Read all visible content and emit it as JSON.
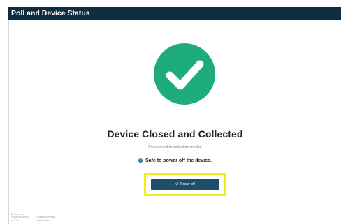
{
  "window": {
    "title": "Poll and Device Status"
  },
  "status": {
    "heading": "Device Closed and Collected",
    "subtext": "Files saved to collection media.",
    "safe_message": "Safe to power off the device.",
    "accent_color": "#1fac7c"
  },
  "actions": {
    "power_off_label": "Power off"
  },
  "footer": {
    "left_lines": [
      "Device Info",
      "SN 0000000000",
      "v 1.0.0"
    ],
    "right_lines": [
      "Collection media",
      "Version info"
    ]
  }
}
